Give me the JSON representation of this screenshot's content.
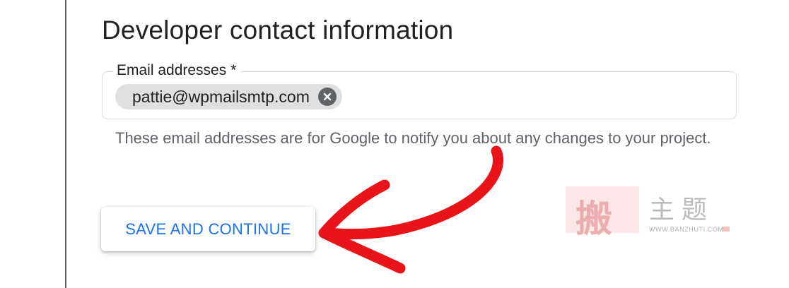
{
  "section": {
    "title": "Developer contact information"
  },
  "email_field": {
    "label": "Email addresses *",
    "chips": [
      {
        "value": "pattie@wpmailsmtp.com",
        "remove_icon": "close-circle-icon"
      }
    ],
    "helper_text": "These email addresses are for Google to notify you about any changes to your project."
  },
  "actions": {
    "save_label": "SAVE AND CONTINUE"
  },
  "annotation": {
    "arrow_icon": "hand-drawn-arrow-icon",
    "color": "#e8141a"
  },
  "watermark": {
    "stamp_char": "搬",
    "chars": "主题",
    "url": "WWW.BANZHUTI.COM"
  },
  "colors": {
    "accent": "#1a73e8",
    "text_primary": "#202124",
    "text_secondary": "#5f6368",
    "chip_bg": "#e0e0e0",
    "border": "#dadce0"
  }
}
